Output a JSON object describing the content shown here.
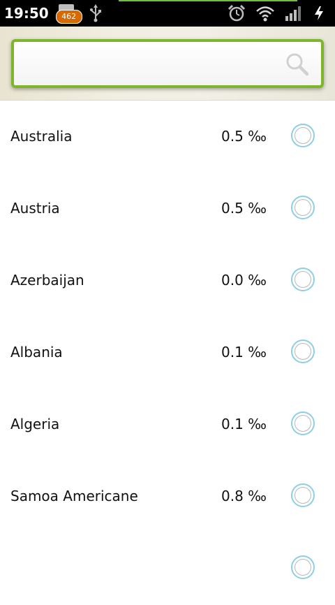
{
  "status_bar": {
    "time": "19:50",
    "notification_count": "462",
    "icons": [
      "mail-icon",
      "usb-icon",
      "alarm-icon",
      "wifi-icon",
      "signal-icon",
      "charging-icon"
    ]
  },
  "search": {
    "value": "",
    "placeholder": "",
    "icon": "search-icon",
    "accent_color": "#7db62c"
  },
  "list": {
    "items": [
      {
        "country": "Australia",
        "value": "0.5 ‰"
      },
      {
        "country": "Austria",
        "value": "0.5 ‰"
      },
      {
        "country": "Azerbaijan",
        "value": "0.0 ‰"
      },
      {
        "country": "Albania",
        "value": "0.1 ‰"
      },
      {
        "country": "Algeria",
        "value": "0.1 ‰"
      },
      {
        "country": "Samoa Americane",
        "value": "0.8 ‰"
      },
      {
        "country": "",
        "value": ""
      }
    ],
    "radio_color": "#8ccfe6"
  }
}
